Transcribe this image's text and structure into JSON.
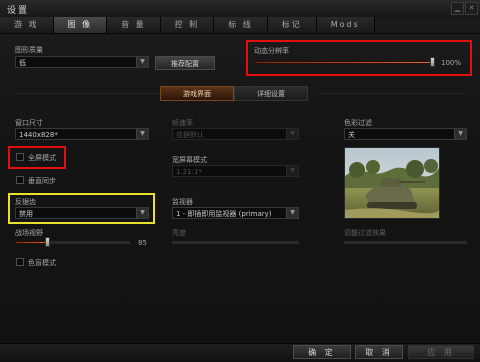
{
  "window": {
    "title": "设置"
  },
  "tabs": [
    "游 戏",
    "图 像",
    "音 量",
    "控 制",
    "标 线",
    "标记",
    "Mods"
  ],
  "graphics_quality": {
    "label": "图形质量",
    "value": "低",
    "button": "推荐配置"
  },
  "dynamic_resolution": {
    "label": "动态分辨率",
    "value_text": "100%",
    "value": 100
  },
  "subtabs": [
    "游戏界面",
    "详细设置"
  ],
  "window_size": {
    "label": "窗口尺寸",
    "value": "1440x828*"
  },
  "fullscreen": {
    "label": "全屏模式",
    "checked": false
  },
  "vsync": {
    "label": "垂直同步",
    "checked": false
  },
  "antialiasing": {
    "label": "反锯齿",
    "value": "禁用"
  },
  "fov": {
    "label": "战场视野",
    "value_text": "85",
    "value": 85
  },
  "colorblind": {
    "label": "色盲模式",
    "checked": false
  },
  "refresh_rate": {
    "label": "帧速率",
    "value": "依据默认"
  },
  "widescreen": {
    "label": "宽屏幕模式",
    "value": "1.21:1*"
  },
  "monitor": {
    "label": "监视器",
    "value": "1 - 即插即用监视器 (primary)"
  },
  "brightness": {
    "label": "亮度"
  },
  "color_filter": {
    "label": "色彩过滤",
    "value": "关"
  },
  "filter_effect": {
    "label": "调整过滤效果"
  },
  "footer": {
    "ok": "确 定",
    "cancel": "取 消",
    "apply": "应 用"
  },
  "icons": {
    "close": "close-icon",
    "minimize": "minimize-icon",
    "dropdown": "chevron-down-icon"
  }
}
